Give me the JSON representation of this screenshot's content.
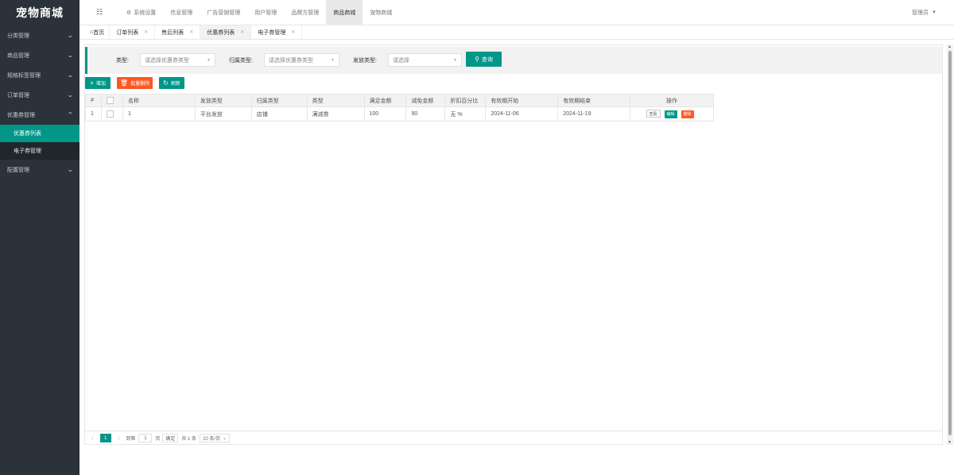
{
  "app": {
    "logo": "宠物商城"
  },
  "sidebar": {
    "items": [
      {
        "label": "分类管理"
      },
      {
        "label": "商品管理"
      },
      {
        "label": "规格标签管理"
      },
      {
        "label": "订单管理"
      },
      {
        "label": "优惠券管理"
      },
      {
        "label": "配置管理"
      }
    ],
    "sub_items": [
      {
        "label": "优惠券列表"
      },
      {
        "label": "电子券管理"
      }
    ]
  },
  "topnav": {
    "toggle_icon": "☷",
    "items": [
      {
        "label": "系统设置"
      },
      {
        "label": "信息管理"
      },
      {
        "label": "广告营销管理"
      },
      {
        "label": "用户管理"
      },
      {
        "label": "品牌方管理"
      },
      {
        "label": "商品商城"
      },
      {
        "label": "宠物商城"
      }
    ],
    "user": "管理员"
  },
  "tabs": {
    "home": "首页",
    "items": [
      {
        "label": "订单列表"
      },
      {
        "label": "售后列表"
      },
      {
        "label": "优惠券列表"
      },
      {
        "label": "电子券管理"
      }
    ]
  },
  "filter": {
    "type_label": "类型:",
    "type_placeholder": "请选择优惠券类型",
    "belong_label": "归属类型:",
    "belong_placeholder": "请选择优惠券类型",
    "issue_label": "发放类型:",
    "issue_placeholder": "请选择",
    "search_label": "查询"
  },
  "toolbar": {
    "add_label": "增加",
    "batch_delete_label": "批量删除",
    "refresh_label": "刷新"
  },
  "table": {
    "headers": [
      "#",
      "",
      "名称",
      "发放类型",
      "归属类型",
      "类型",
      "满足金额",
      "减免金额",
      "折扣百分比",
      "有效期开始",
      "有效期结束",
      "操作"
    ],
    "rows": [
      {
        "index": "1",
        "name": "1",
        "issue_type": "平台发放",
        "belong_type": "店铺",
        "type": "满减券",
        "threshold": "100",
        "reduce": "90",
        "discount": "无 %",
        "start": "2024-11-06",
        "end": "2024-11-19",
        "ops": {
          "view": "查看",
          "edit": "编辑",
          "delete": "删除"
        }
      }
    ]
  },
  "pagination": {
    "current": "1",
    "goto_label": "到第",
    "goto_value": "1",
    "page_unit": "页",
    "confirm": "确定",
    "total": "共 1 条",
    "page_size": "10 条/页"
  },
  "colors": {
    "primary": "#009688",
    "danger": "#ff5722",
    "sidebar": "#2b323a"
  }
}
